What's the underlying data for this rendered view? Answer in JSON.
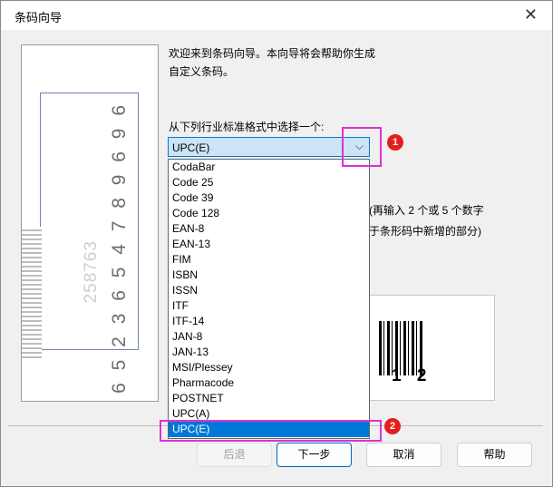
{
  "window": {
    "title": "条码向导",
    "close_glyph": "✕"
  },
  "left_image": {
    "main_digits": "6 5 2 3 6 5 4 7 8 9 6 9 6",
    "sub_digits": "258763"
  },
  "intro_text": "欢迎来到条码向导。本向导将会帮助你生成自定义条码。",
  "prompt": "从下列行业标准格式中选择一个:",
  "format_select": {
    "value": "UPC(E)",
    "arrow": "⌵"
  },
  "format_options": [
    "CodaBar",
    "Code 25",
    "Code 39",
    "Code 128",
    "EAN-8",
    "EAN-13",
    "FIM",
    "ISBN",
    "ISSN",
    "ITF",
    "ITF-14",
    "JAN-8",
    "JAN-13",
    "MSI/Plessey",
    "Pharmacode",
    "POSTNET",
    "UPC(A)",
    "UPC(E)"
  ],
  "selected_option": "UPC(E)",
  "hint_line1": "(再输入 2 个或 5 个数字",
  "hint_line2": "于条形码中新增的部分)",
  "preview_digits": "1 2",
  "buttons": {
    "back": "后退",
    "next": "下一步",
    "cancel": "取消",
    "help": "帮助"
  },
  "annotations": {
    "badge1": "1",
    "badge2": "2"
  },
  "colors": {
    "highlight": "#e030d6",
    "badge": "#e41e1e",
    "selection": "#0078d7"
  }
}
